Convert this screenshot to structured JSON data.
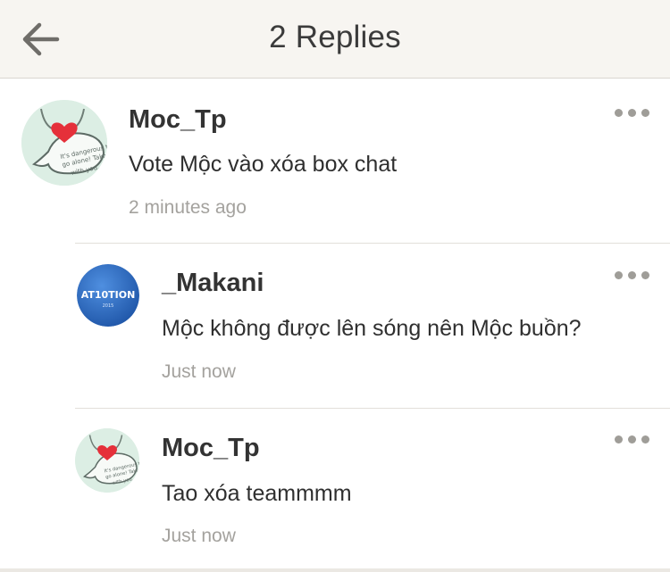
{
  "header": {
    "back_icon": "arrow-left-icon",
    "title": "2 Replies"
  },
  "comments": [
    {
      "author": "Moc_Tp",
      "text": "Vote Mộc vào xóa box chat",
      "time": "2 minutes ago",
      "avatar_icon": "heart-sticker-avatar",
      "avatar_caption": "It's dangerous to go alone! Take this with you."
    },
    {
      "author": "_Makani",
      "text": "Mộc không được lên sóng nên Mộc buồn?",
      "time": "Just now",
      "avatar_icon": "blue-logo-avatar",
      "avatar_caption": "AT10TION"
    },
    {
      "author": "Moc_Tp",
      "text": "Tao xóa teammmm",
      "time": "Just now",
      "avatar_icon": "heart-sticker-avatar",
      "avatar_caption": "It's dangerous to go alone! Take this with you."
    }
  ],
  "colors": {
    "header_bg": "#f7f5f1",
    "text": "#2f2f2f",
    "muted": "#a4a29e",
    "avatar_mint": "#dceee4",
    "avatar_blue": "#2f6fc6",
    "heart": "#e5303a"
  }
}
